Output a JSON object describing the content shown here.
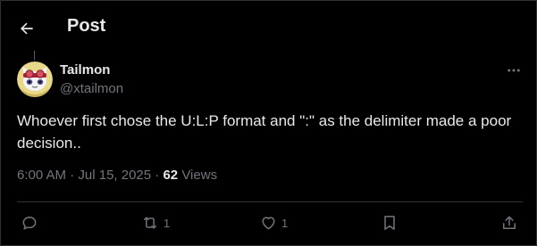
{
  "header": {
    "back_icon": "arrow-left-icon",
    "title": "Post"
  },
  "post": {
    "author_name": "Tailmon",
    "author_handle": "@xtailmon",
    "more_icon": "more-horizontal-icon",
    "text": "Whoever first chose the U:L:P format and \":\" as the delimiter made a poor decision..",
    "time": "6:00 AM",
    "separator1": " · ",
    "date": "Jul 15, 2025",
    "separator2": " · ",
    "views_count": "62",
    "views_label": " Views"
  },
  "actions": {
    "reply_icon": "reply-icon",
    "repost_icon": "repost-icon",
    "repost_count": "1",
    "like_icon": "heart-icon",
    "like_count": "1",
    "bookmark_icon": "bookmark-icon",
    "share_icon": "share-icon"
  },
  "colors": {
    "background": "#000000",
    "text_primary": "#e7e9ea",
    "text_secondary": "#71767b",
    "border": "#2f3336"
  }
}
